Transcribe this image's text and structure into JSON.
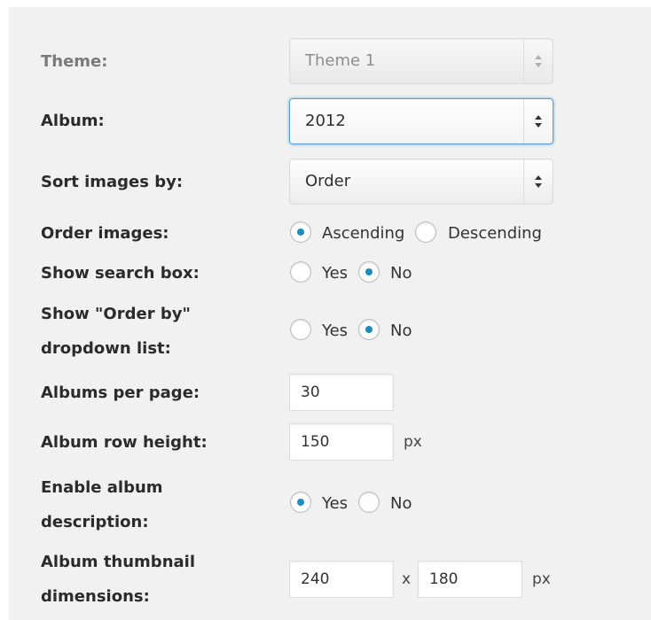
{
  "theme": {
    "label": "Theme:",
    "value": "Theme 1",
    "disabled": true
  },
  "album": {
    "label": "Album:",
    "value": "2012"
  },
  "sort_images": {
    "label": "Sort images by:",
    "value": "Order"
  },
  "order_images": {
    "label": "Order images:",
    "options": [
      "Ascending",
      "Descending"
    ],
    "selected": "Ascending"
  },
  "show_search_box": {
    "label": "Show search box:",
    "options": [
      "Yes",
      "No"
    ],
    "selected": "No"
  },
  "show_order_by": {
    "label_line1": "Show \"Order by\"",
    "label_line2": "dropdown list:",
    "options": [
      "Yes",
      "No"
    ],
    "selected": "No"
  },
  "albums_per_page": {
    "label": "Albums per page:",
    "value": "30"
  },
  "album_row_height": {
    "label": "Album row height:",
    "value": "150",
    "unit": "px"
  },
  "enable_album_description": {
    "label_line1": "Enable album",
    "label_line2": "description:",
    "options": [
      "Yes",
      "No"
    ],
    "selected": "Yes"
  },
  "album_thumbnail_dimensions": {
    "label_line1": "Album thumbnail",
    "label_line2": "dimensions:",
    "width": "240",
    "separator": "x",
    "height": "180",
    "unit": "px"
  },
  "colors": {
    "panel_bg": "#f1f1f1",
    "radio_checked": "#1e8cbe",
    "focus_border": "#5b9dd9"
  }
}
